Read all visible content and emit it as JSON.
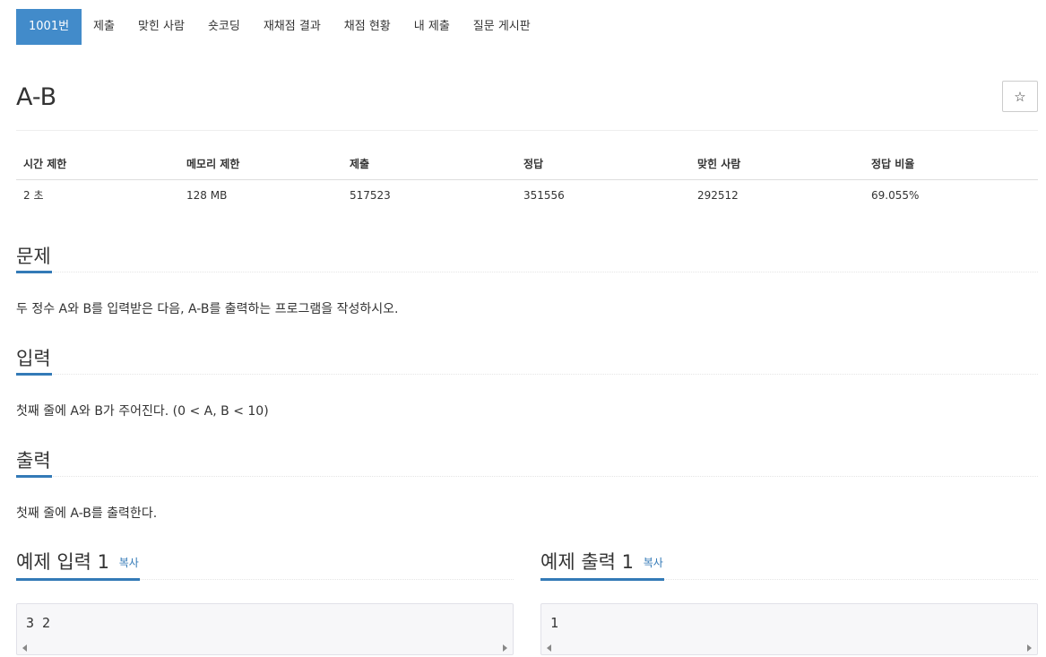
{
  "nav": {
    "items": [
      {
        "label": "1001번",
        "active": true
      },
      {
        "label": "제출"
      },
      {
        "label": "맞힌 사람"
      },
      {
        "label": "숏코딩"
      },
      {
        "label": "재채점 결과"
      },
      {
        "label": "채점 현황"
      },
      {
        "label": "내 제출"
      },
      {
        "label": "질문 게시판"
      }
    ]
  },
  "problem": {
    "title": "A-B",
    "star_icon": "☆"
  },
  "info": {
    "headers": [
      "시간 제한",
      "메모리 제한",
      "제출",
      "정답",
      "맞힌 사람",
      "정답 비율"
    ],
    "values": [
      "2 초",
      "128 MB",
      "517523",
      "351556",
      "292512",
      "69.055%"
    ]
  },
  "sections": {
    "description": {
      "heading": "문제",
      "text": "두 정수 A와 B를 입력받은 다음, A-B를 출력하는 프로그램을 작성하시오."
    },
    "input": {
      "heading": "입력",
      "text": "첫째 줄에 A와 B가 주어진다. (0 < A, B < 10)"
    },
    "output": {
      "heading": "출력",
      "text": "첫째 줄에 A-B를 출력한다."
    }
  },
  "samples": {
    "input": {
      "heading": "예제 입력 1",
      "copy_label": "복사",
      "content": "3 2"
    },
    "output": {
      "heading": "예제 출력 1",
      "copy_label": "복사",
      "content": "1"
    }
  },
  "colors": {
    "accent": "#428bca",
    "link": "#337ab7",
    "code_bg": "#f7f7f9"
  }
}
